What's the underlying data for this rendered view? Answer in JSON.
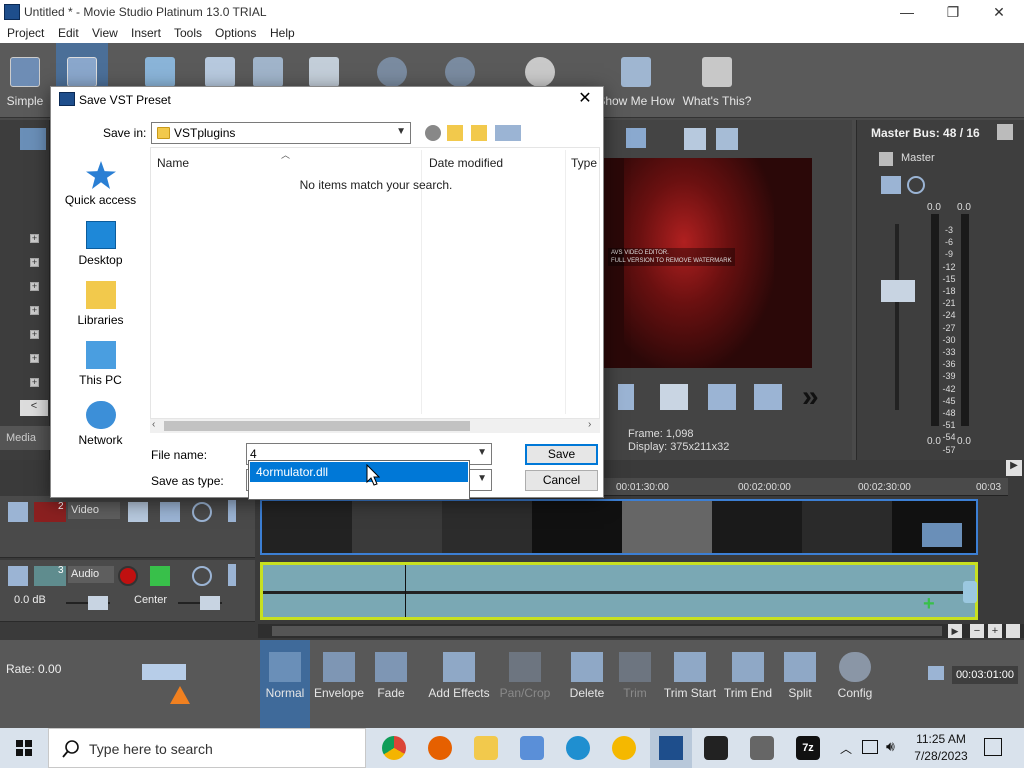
{
  "window": {
    "title": "Untitled * - Movie Studio Platinum 13.0 TRIAL"
  },
  "window_controls": {
    "minimize": "—",
    "maximize": "❐",
    "close": "✕"
  },
  "menu": [
    "Project",
    "Edit",
    "View",
    "Insert",
    "Tools",
    "Options",
    "Help"
  ],
  "toolbar": {
    "simple": "Simple",
    "show_me_how": "Show Me How",
    "whats_this": "What's This?"
  },
  "left_panel": {
    "media_tab": "Media"
  },
  "preview": {
    "watermark_line1": "AVS VIDEO EDITOR.",
    "watermark_line2": "FULL VERSION TO REMOVE WATERMARK",
    "frame_label": "Frame:",
    "frame_value": "1,098",
    "display_label": "Display:",
    "display_value": "375x211x32"
  },
  "master_bus": {
    "title": "Master Bus: 48 / 16",
    "sub": "Master",
    "peak_left": "0.0",
    "peak_right": "0.0",
    "scale": [
      "3",
      "6",
      "9",
      "12",
      "15",
      "18",
      "21",
      "24",
      "27",
      "30",
      "33",
      "36",
      "39",
      "42",
      "45",
      "48",
      "51",
      "54",
      "57"
    ],
    "bottom_left": "0.0",
    "bottom_right": "0.0"
  },
  "timeline": {
    "ruler": [
      "00:01:30:00",
      "00:02:00:00",
      "00:02:30:00",
      "00:03"
    ],
    "video_track": {
      "number": "2",
      "name": "Video"
    },
    "audio_track": {
      "number": "3",
      "name": "Audio",
      "volume": "0.0 dB",
      "pan": "Center"
    }
  },
  "rate": "Rate: 0.00",
  "edit_tools": [
    {
      "label": "Normal",
      "state": "active"
    },
    {
      "label": "Envelope",
      "state": "normal"
    },
    {
      "label": "Fade",
      "state": "normal"
    },
    {
      "label": "Add Effects",
      "state": "normal"
    },
    {
      "label": "Pan/Crop",
      "state": "disabled"
    },
    {
      "label": "Delete",
      "state": "normal"
    },
    {
      "label": "Trim",
      "state": "disabled"
    },
    {
      "label": "Trim Start",
      "state": "normal"
    },
    {
      "label": "Trim End",
      "state": "normal"
    },
    {
      "label": "Split",
      "state": "normal"
    },
    {
      "label": "Config",
      "state": "normal"
    }
  ],
  "timecode": "00:03:01:00",
  "dialog": {
    "title": "Save VST Preset",
    "save_in_label": "Save in:",
    "save_in_value": "VSTplugins",
    "places": [
      "Quick access",
      "Desktop",
      "Libraries",
      "This PC",
      "Network"
    ],
    "columns": [
      "Name",
      "Date modified",
      "Type"
    ],
    "empty_message": "No items match your search.",
    "file_name_label": "File name:",
    "file_name_value": "4",
    "save_as_type_label": "Save as type:",
    "save_button": "Save",
    "cancel_button": "Cancel",
    "autocomplete": [
      "4ormulator.dll"
    ]
  },
  "taskbar": {
    "search_placeholder": "Type here to search",
    "time": "11:25 AM",
    "date": "7/28/2023"
  }
}
